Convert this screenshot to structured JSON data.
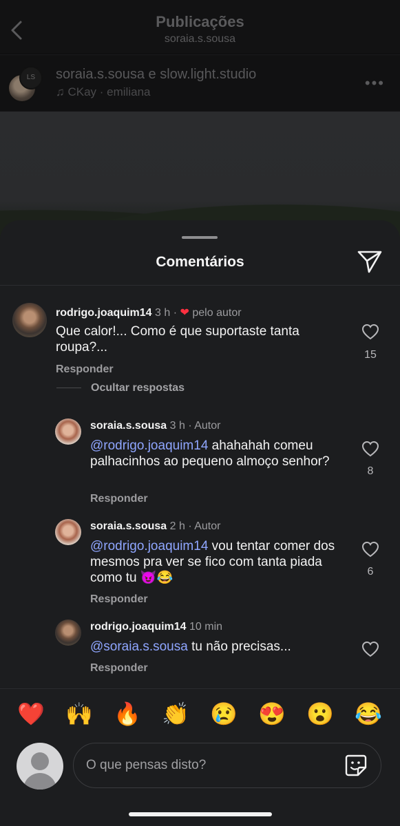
{
  "header": {
    "title": "Publicações",
    "subtitle": "soraia.s.sousa"
  },
  "post": {
    "authors": "soraia.s.sousa e slow.light.studio",
    "music": "CKay · emiliana"
  },
  "sheet": {
    "title": "Comentários"
  },
  "comments": [
    {
      "username": "rodrigo.joaquim14",
      "time": "3 h",
      "separator": "·",
      "badge": "pelo autor",
      "text": "Que calor!... Como é que suportaste tanta roupa?...",
      "reply_label": "Responder",
      "likes": "15"
    },
    {
      "username": "soraia.s.sousa",
      "time": "3 h · Autor",
      "mention": "@rodrigo.joaquim14",
      "text": " ahahahah comeu palhacinhos ao pequeno almoço senhor?",
      "reply_label": "Responder",
      "likes": "8"
    },
    {
      "username": "soraia.s.sousa",
      "time": "2 h · Autor",
      "mention": "@rodrigo.joaquim14",
      "text": " vou tentar comer dos mesmos pra ver se fico com tanta piada como tu 😈😂",
      "reply_label": "Responder",
      "likes": "6"
    },
    {
      "username": "rodrigo.joaquim14",
      "time": "10 min",
      "mention": "@soraia.s.sousa",
      "text": " tu não precisas...",
      "reply_label": "Responder"
    }
  ],
  "hide_replies_label": "Ocultar respostas",
  "emoji_bar": [
    "❤️",
    "🙌",
    "🔥",
    "👏",
    "😢",
    "😍",
    "😮",
    "😂"
  ],
  "composer": {
    "placeholder": "O que pensas disto?"
  },
  "colors": {
    "sheet_bg": "#1c1d1f",
    "mention": "#8fa6ff",
    "heart_red": "#ff3040"
  },
  "icons": [
    "chevron-left-icon",
    "more-icon",
    "music-note-icon",
    "share-icon",
    "heart-icon",
    "sticker-icon"
  ]
}
